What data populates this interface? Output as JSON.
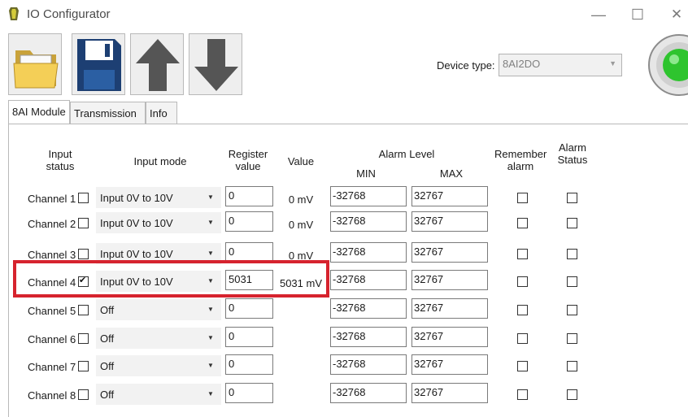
{
  "window": {
    "title": "IO Configurator",
    "controls": [
      "—",
      "☐",
      "✕"
    ]
  },
  "toolbar": {
    "buttons": [
      {
        "name": "open",
        "icon": "folder-icon"
      },
      {
        "name": "save",
        "icon": "floppy-disk-icon"
      },
      {
        "name": "upload",
        "icon": "arrow-up-icon"
      },
      {
        "name": "download",
        "icon": "arrow-down-icon"
      }
    ],
    "device_type_label": "Device type:",
    "device_type_value": "8AI2DO",
    "status_led_color": "#2ec42e"
  },
  "tabs": [
    {
      "label": "8AI Module",
      "active": true
    },
    {
      "label": "Transmission",
      "active": false
    },
    {
      "label": "Info",
      "active": false
    }
  ],
  "headers": {
    "input_status": "Input status",
    "input_mode": "Input mode",
    "register_value": "Register value",
    "value": "Value",
    "alarm_level": "Alarm Level",
    "min": "MIN",
    "max": "MAX",
    "remember_alarm": "Remember alarm",
    "alarm_status": "Alarm Status"
  },
  "channels": [
    {
      "label": "Channel 1",
      "enabled": false,
      "mode": "Input 0V to 10V",
      "register": "0",
      "value": "0 mV",
      "min": "-32768",
      "max": "32767",
      "remember": false,
      "alarm": false
    },
    {
      "label": "Channel 2",
      "enabled": false,
      "mode": "Input 0V to 10V",
      "register": "0",
      "value": "0 mV",
      "min": "-32768",
      "max": "32767",
      "remember": false,
      "alarm": false
    },
    {
      "label": "Channel 3",
      "enabled": false,
      "mode": "Input 0V to 10V",
      "register": "0",
      "value": "0 mV",
      "min": "-32768",
      "max": "32767",
      "remember": false,
      "alarm": false
    },
    {
      "label": "Channel 4",
      "enabled": true,
      "mode": "Input 0V to 10V",
      "register": "5031",
      "value": "5031 mV",
      "min": "-32768",
      "max": "32767",
      "remember": false,
      "alarm": false
    },
    {
      "label": "Channel 5",
      "enabled": false,
      "mode": "Off",
      "register": "0",
      "value": "",
      "min": "-32768",
      "max": "32767",
      "remember": false,
      "alarm": false
    },
    {
      "label": "Channel 6",
      "enabled": false,
      "mode": "Off",
      "register": "0",
      "value": "",
      "min": "-32768",
      "max": "32767",
      "remember": false,
      "alarm": false
    },
    {
      "label": "Channel 7",
      "enabled": false,
      "mode": "Off",
      "register": "0",
      "value": "",
      "min": "-32768",
      "max": "32767",
      "remember": false,
      "alarm": false
    },
    {
      "label": "Channel 8",
      "enabled": false,
      "mode": "Off",
      "register": "0",
      "value": "",
      "min": "-32768",
      "max": "32767",
      "remember": false,
      "alarm": false
    }
  ],
  "highlight": {
    "color": "#d6232e",
    "row": "Channel 4"
  },
  "dropdown_caret": "▼"
}
